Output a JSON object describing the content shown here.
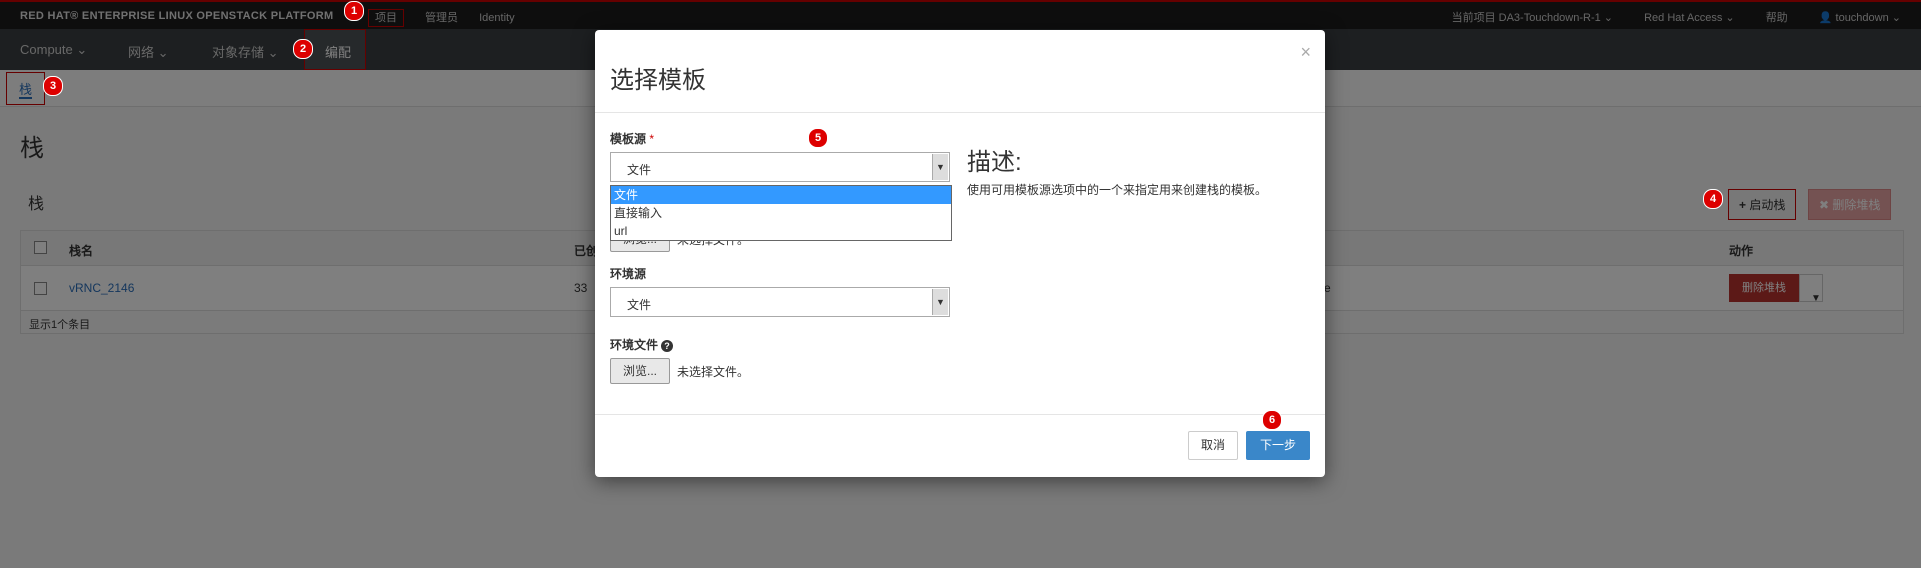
{
  "topbar": {
    "brand": "RED HAT® ENTERPRISE LINUX OPENSTACK PLATFORM",
    "nav": [
      "项目",
      "管理员",
      "Identity"
    ],
    "current_project": "当前项目 DA3-Touchdown-R-1 ⌄",
    "red_hat_access": "Red Hat Access ⌄",
    "help": "帮助",
    "user": "touchdown ⌄"
  },
  "secnav": {
    "items": [
      "Compute ⌄",
      "网络 ⌄",
      "对象存储 ⌄"
    ],
    "active": "编配"
  },
  "tabs": {
    "active": "栈"
  },
  "page": {
    "title": "栈",
    "section": "栈",
    "launch_button": "启动栈",
    "delete_button": "✖ 删除堆栈"
  },
  "table": {
    "headers": [
      "栈名",
      "已创",
      "动作"
    ],
    "rows": [
      {
        "name": "vRNC_2146",
        "created": "33",
        "status_tail": "e",
        "action": "删除堆栈"
      }
    ],
    "footer": "显示1个条目"
  },
  "modal": {
    "title": "选择模板",
    "close": "×",
    "template_source_label": "模板源",
    "template_source_required": "*",
    "template_source_value": "文件",
    "dropdown_options": [
      "文件",
      "直接输入",
      "url"
    ],
    "browse_label": "浏览...",
    "no_file_text": "未选择文件。",
    "env_source_label": "环境源",
    "env_source_value": "文件",
    "env_file_label": "环境文件",
    "env_help_icon": "?",
    "description_heading": "描述:",
    "description_text": "使用可用模板源选项中的一个来指定用来创建栈的模板。",
    "cancel_button": "取消",
    "next_button": "下一步"
  },
  "annotations": [
    "1",
    "2",
    "3",
    "4",
    "5",
    "6"
  ],
  "colors": {
    "accent_red": "#cc0000",
    "primary_blue": "#3a87c9",
    "danger": "#b8322e"
  }
}
